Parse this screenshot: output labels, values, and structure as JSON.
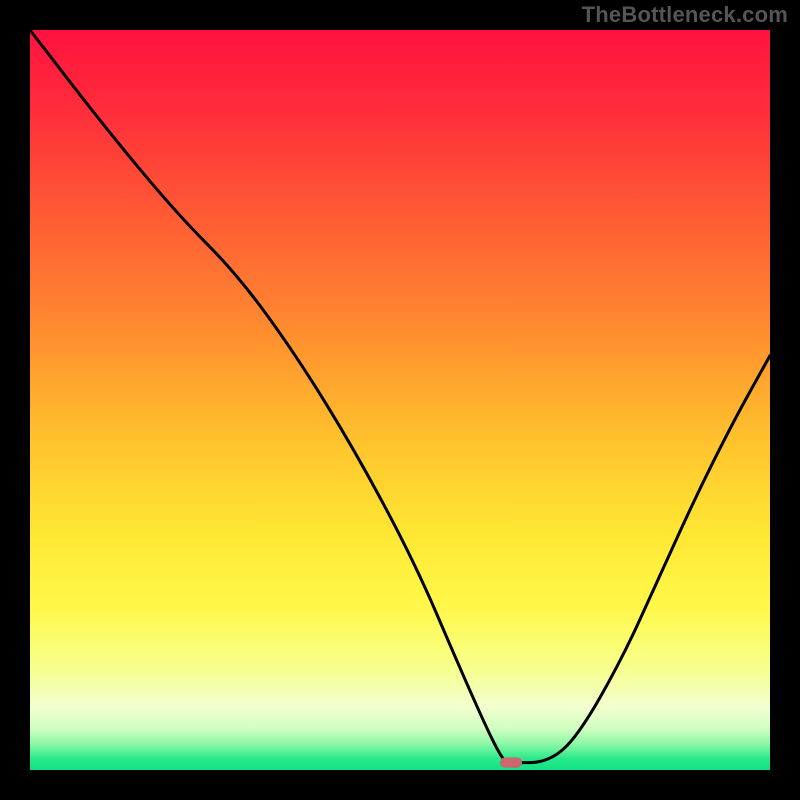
{
  "attribution": "TheBottleneck.com",
  "colors": {
    "frame": "#000000",
    "curve": "#000000",
    "marker": "#c9696b",
    "gradient_stops": [
      {
        "offset": 0.0,
        "color": "#ff1240"
      },
      {
        "offset": 0.1,
        "color": "#ff2b3b"
      },
      {
        "offset": 0.25,
        "color": "#ff5a34"
      },
      {
        "offset": 0.4,
        "color": "#ff8a2f"
      },
      {
        "offset": 0.55,
        "color": "#ffc12d"
      },
      {
        "offset": 0.68,
        "color": "#ffe733"
      },
      {
        "offset": 0.78,
        "color": "#fff84a"
      },
      {
        "offset": 0.86,
        "color": "#f7ff8a"
      },
      {
        "offset": 0.915,
        "color": "#f2ffd0"
      },
      {
        "offset": 0.945,
        "color": "#cfffc0"
      },
      {
        "offset": 0.965,
        "color": "#8cf7a7"
      },
      {
        "offset": 0.985,
        "color": "#28e98a"
      },
      {
        "offset": 1.0,
        "color": "#12e184"
      }
    ]
  },
  "chart_data": {
    "type": "line",
    "title": "",
    "xlabel": "",
    "ylabel": "",
    "xlim": [
      0,
      100
    ],
    "ylim": [
      0,
      100
    ],
    "grid": false,
    "legend": null,
    "series": [
      {
        "name": "bottleneck-curve",
        "x": [
          0,
          10,
          20,
          28,
          36,
          44,
          52,
          58,
          62,
          64,
          65,
          70,
          74,
          80,
          85,
          90,
          95,
          100
        ],
        "values": [
          100,
          87,
          75,
          67,
          56,
          43,
          28,
          14,
          5,
          1.2,
          1.0,
          1.0,
          4.5,
          15,
          26,
          37,
          47,
          56
        ]
      }
    ],
    "marker": {
      "x": 65,
      "y": 1.0,
      "width": 3.0,
      "height": 1.4
    }
  }
}
